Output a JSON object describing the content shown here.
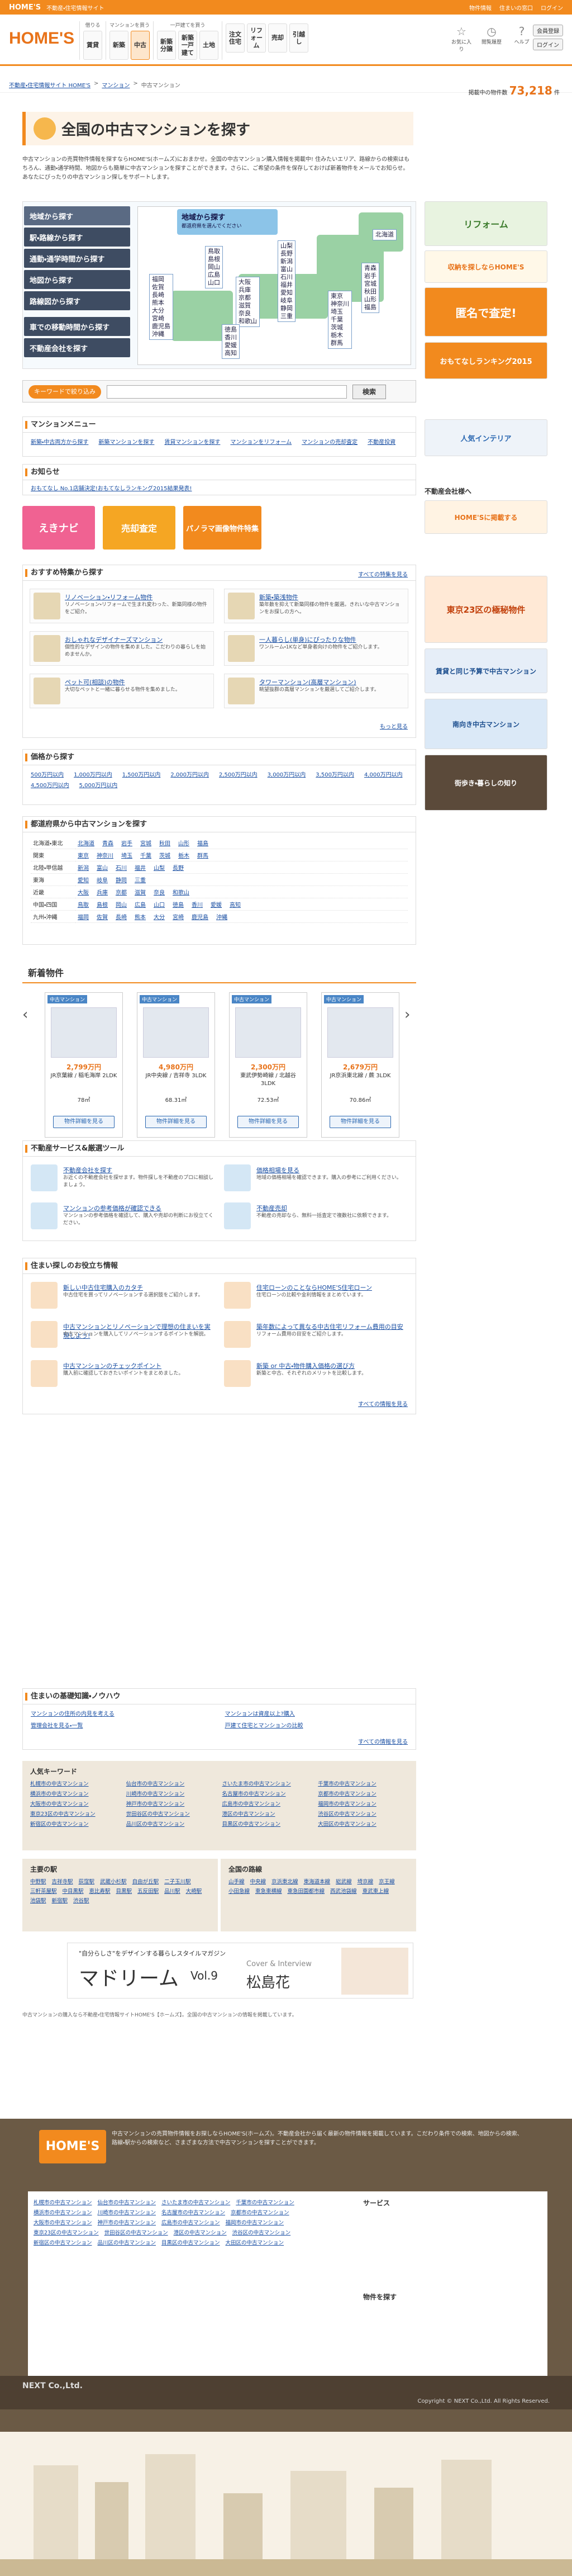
{
  "topbar": {
    "brand": "HOME'S",
    "tagline": "不動産・住宅情報サイト",
    "links": [
      "物件情報",
      "住まいの窓口",
      "ログイン"
    ]
  },
  "header": {
    "logo": "HOME'S",
    "gnav": [
      {
        "cap": "借りる",
        "items": [
          "賃貸"
        ]
      },
      {
        "cap": "マンションを買う",
        "items": [
          "新築",
          "中古"
        ]
      },
      {
        "cap": "一戸建てを買う",
        "items": [
          "新築分譲",
          "新築一戸建て",
          "土地"
        ]
      },
      {
        "cap": "",
        "items": [
          "注文住宅",
          "リフォーム",
          "売却",
          "引越し"
        ]
      }
    ],
    "icons": [
      {
        "name": "お気に入り",
        "g": "☆"
      },
      {
        "name": "閲覧履歴",
        "g": "◷"
      },
      {
        "name": "ヘルプ",
        "g": "?"
      }
    ],
    "buttons": [
      "会員登録",
      "ログイン"
    ]
  },
  "breadcrumb": {
    "crumbs": [
      "不動産・住宅情報サイト HOME'S",
      "マンション",
      "中古マンション"
    ]
  },
  "count": {
    "label": "掲載中の物件数",
    "value": "73,218",
    "unit": "件"
  },
  "page": {
    "title": "全国の中古マンションを探す",
    "intro": "中古マンションの売買物件情報を探すならHOME'S(ホームズ)におまかせ。全国の中古マンション購入情報を掲載中! 住みたいエリア、路線からの検索はもちろん、通勤・通学時間、地図からも簡単に中古マンションを探すことができます。さらに、ご希望の条件を保存しておけば新着物件をメールでお知らせ。あなたにぴったりの中古マンション探しをサポートします。"
  },
  "search": {
    "buttons": [
      "地域から探す",
      "駅・路線から探す",
      "通勤・通学時間から探す",
      "地図から探す",
      "路線図から探す",
      "車での移動時間から探す",
      "不動産会社を探す"
    ],
    "map_title": "地域から探す",
    "map_sub": "都道府県を選んでください",
    "prefs_north": [
      "北海道"
    ],
    "prefs_tohoku": [
      "青森",
      "岩手",
      "宮城",
      "秋田",
      "山形",
      "福島"
    ],
    "prefs_kanto": [
      "東京",
      "神奈川",
      "埼玉",
      "千葉",
      "茨城",
      "栃木",
      "群馬"
    ],
    "prefs_chubu": [
      "山梨",
      "長野",
      "新潟",
      "富山",
      "石川",
      "福井",
      "愛知",
      "岐阜",
      "静岡",
      "三重"
    ],
    "prefs_kinki": [
      "大阪",
      "兵庫",
      "京都",
      "滋賀",
      "奈良",
      "和歌山"
    ],
    "prefs_west": [
      "鳥取",
      "島根",
      "岡山",
      "広島",
      "山口"
    ],
    "prefs_shikoku": [
      "徳島",
      "香川",
      "愛媛",
      "高知"
    ],
    "prefs_kyushu": [
      "福岡",
      "佐賀",
      "長崎",
      "熊本",
      "大分",
      "宮崎",
      "鹿児島",
      "沖縄"
    ]
  },
  "keyword": {
    "label": "キーワードで絞り込み",
    "button": "検索"
  },
  "menu": {
    "title": "マンションメニュー",
    "links": [
      "新築・中古両方から探す",
      "新築マンションを探す",
      "賃貸マンションを探す",
      "マンションをリフォーム",
      "マンションの売却査定",
      "不動産投資"
    ]
  },
  "notice": {
    "title": "お知らせ",
    "text": "おもてなし No.1店舗決定!おもてなしランキング2015結果発表!"
  },
  "promos": [
    "えきナビ",
    "売却査定",
    "パノラマ画像物件特集"
  ],
  "features": {
    "title": "おすすめ特集から探す",
    "more": "すべての特集を見る",
    "items": [
      {
        "t1": "リノベーション・リフォーム物件",
        "t2": "リノベーション・リフォームで生まれ変わった、新築同様の物件をご紹介。"
      },
      {
        "t1": "新築・築浅物件",
        "t2": "築年数を抑えて新築同様の物件を厳選。きれいな中古マンションをお探しの方へ。"
      },
      {
        "t1": "おしゃれなデザイナーズマンション",
        "t2": "個性的なデザインの物件を集めました。こだわりの暮らしを始めませんか。"
      },
      {
        "t1": "一人暮らし(単身)にぴったりな物件",
        "t2": "ワンルーム・1Kなど単身者向けの物件をご紹介します。"
      },
      {
        "t1": "ペット可(相談)の物件",
        "t2": "大切なペットと一緒に暮らせる物件を集めました。"
      },
      {
        "t1": "タワーマンション(高層マンション)",
        "t2": "眺望抜群の高層マンションを厳選してご紹介します。"
      }
    ],
    "more2": "もっと見る"
  },
  "price": {
    "title": "価格から探す",
    "links": [
      "500万円以内",
      "1,000万円以内",
      "1,500万円以内",
      "2,000万円以内",
      "2,500万円以内",
      "3,000万円以内",
      "3,500万円以内",
      "4,000万円以内",
      "4,500万円以内",
      "5,000万円以内"
    ]
  },
  "region": {
    "title": "都道府県から中古マンションを探す",
    "rows": [
      {
        "r": "北海道・東北",
        "p": [
          "北海道",
          "青森",
          "岩手",
          "宮城",
          "秋田",
          "山形",
          "福島"
        ]
      },
      {
        "r": "関東",
        "p": [
          "東京",
          "神奈川",
          "埼玉",
          "千葉",
          "茨城",
          "栃木",
          "群馬"
        ]
      },
      {
        "r": "北陸・甲信越",
        "p": [
          "新潟",
          "富山",
          "石川",
          "福井",
          "山梨",
          "長野"
        ]
      },
      {
        "r": "東海",
        "p": [
          "愛知",
          "岐阜",
          "静岡",
          "三重"
        ]
      },
      {
        "r": "近畿",
        "p": [
          "大阪",
          "兵庫",
          "京都",
          "滋賀",
          "奈良",
          "和歌山"
        ]
      },
      {
        "r": "中国・四国",
        "p": [
          "鳥取",
          "島根",
          "岡山",
          "広島",
          "山口",
          "徳島",
          "香川",
          "愛媛",
          "高知"
        ]
      },
      {
        "r": "九州・沖縄",
        "p": [
          "福岡",
          "佐賀",
          "長崎",
          "熊本",
          "大分",
          "宮崎",
          "鹿児島",
          "沖縄"
        ]
      }
    ]
  },
  "newprops": {
    "title": "新着物件",
    "cards": [
      {
        "badge": "中古マンション",
        "price": "2,799万円",
        "name": "JR京葉線 / 稲毛海岸 2LDK",
        "area": "78㎡",
        "go": "物件詳細を見る"
      },
      {
        "badge": "中古マンション",
        "price": "4,980万円",
        "name": "JR中央線 / 吉祥寺 3LDK",
        "area": "68.31㎡",
        "go": "物件詳細を見る"
      },
      {
        "badge": "中古マンション",
        "price": "2,300万円",
        "name": "東武伊勢崎線 / 北越谷 3LDK",
        "area": "72.53㎡",
        "go": "物件詳細を見る"
      },
      {
        "badge": "中古マンション",
        "price": "2,679万円",
        "name": "JR京浜東北線 / 蕨 3LDK",
        "area": "70.86㎡",
        "go": "物件詳細を見る"
      }
    ]
  },
  "tools": {
    "title": "不動産サービス&厳選ツール",
    "items": [
      {
        "t1": "不動産会社を探す",
        "t2": "お近くの不動産会社を探せます。物件探しを不動産のプロに相談しましょう。"
      },
      {
        "t1": "価格相場を見る",
        "t2": "地域の価格相場を確認できます。購入の参考にご利用ください。"
      },
      {
        "t1": "マンションの参考価格が確認できる",
        "t2": "マンションの参考価格を確認して、購入や売却の判断にお役立てください。"
      },
      {
        "t1": "不動産売却",
        "t2": "不動産の売却なら、無料一括査定で複数社に依頼できます。"
      }
    ]
  },
  "info": {
    "title": "住まい探しのお役立ち情報",
    "items": [
      {
        "t1": "新しい中古住宅購入のカタチ",
        "t2": "中古住宅を買ってリノベーションする選択肢をご紹介します。"
      },
      {
        "t1": "住宅ローンのことならHOME'S住宅ローン",
        "t2": "住宅ローンの比較や金利情報をまとめています。"
      },
      {
        "t1": "中古マンションとリノベーションで理想の住まいを実現しよう!",
        "t2": "中古マンションを購入してリノベーションするポイントを解説。"
      },
      {
        "t1": "築年数によって異なる中古住宅リフォーム費用の目安",
        "t2": "リフォーム費用の目安をご紹介します。"
      },
      {
        "t1": "中古マンションのチェックポイント",
        "t2": "購入前に確認しておきたいポイントをまとめました。"
      },
      {
        "t1": "新築 or 中古・物件購入価格の選び方",
        "t2": "新築と中古、それぞれのメリットを比較します。"
      }
    ],
    "more": "すべての情報を見る"
  },
  "knowhow": {
    "title": "住まいの基礎知識・ノウハウ",
    "links": [
      "マンションの住所の内見を考える",
      "管理会社を見る・一覧",
      "マンションは資産以上?購入",
      "戸建て住宅とマンションの比較",
      "マンション購入の流れ",
      "資金計画の立て方"
    ],
    "more": "すべての情報を見る"
  },
  "keywords": {
    "title": "人気キーワード",
    "items": [
      "札幌市の中古マンション",
      "仙台市の中古マンション",
      "さいたま市の中古マンション",
      "千葉市の中古マンション",
      "横浜市の中古マンション",
      "川崎市の中古マンション",
      "名古屋市の中古マンション",
      "京都市の中古マンション",
      "大阪市の中古マンション",
      "神戸市の中古マンション",
      "広島市の中古マンション",
      "福岡市の中古マンション",
      "東京23区の中古マンション",
      "世田谷区の中古マンション",
      "港区の中古マンション",
      "渋谷区の中古マンション",
      "新宿区の中古マンション",
      "品川区の中古マンション",
      "目黒区の中古マンション",
      "大田区の中古マンション"
    ]
  },
  "stations": {
    "left_title": "主要の駅",
    "left": [
      "中野駅",
      "吉祥寺駅",
      "荻窪駅",
      "武蔵小杉駅",
      "自由が丘駅",
      "二子玉川駅",
      "三軒茶屋駅",
      "中目黒駅",
      "恵比寿駅",
      "目黒駅",
      "五反田駅",
      "品川駅",
      "大崎駅",
      "池袋駅",
      "新宿駅",
      "渋谷駅"
    ],
    "right_title": "全国の路線",
    "right": [
      "山手線",
      "中央線",
      "京浜東北線",
      "東海道本線",
      "総武線",
      "埼京線",
      "京王線",
      "小田急線",
      "東急東横線",
      "東急田園都市線",
      "西武池袋線",
      "東武東上線"
    ]
  },
  "magazine": {
    "kicker": "\"自分らしさ\"をデザインする暮らしスタイルマガジン",
    "title": "マドリーム",
    "vol": "Vol.9",
    "cover": "Cover & Interview",
    "person": "松島花"
  },
  "disclaimer": "中古マンションの購入なら不動産・住宅情報サイトHOME'S【ホームズ】。全国の中古マンションの情報を掲載しています。",
  "sidebar": {
    "b1": "リフォーム",
    "b2": "収納を探しならHOME'S",
    "b3": "匿名で査定!",
    "b4": "おもてなしランキング2015",
    "b5": "人気インテリア",
    "b6": "不動産会社様へ",
    "b7": "HOME'Sに掲載する",
    "b8": "東京23区の極秘物件",
    "b9": "賃貸と同じ予算で中古マンション",
    "b10": "南向き中古マンション",
    "b11": "街歩き・暮らしの知り"
  },
  "footer": {
    "logo": "HOME'S",
    "desc": "中古マンションの売買物件情報をお探しならHOME'S(ホームズ)。不動産会社から届く最新の物件情報を掲載しています。こだわり条件での検索、地図からの検索、路線・駅からの検索など、さまざまな方法で中古マンションを探すことができます。",
    "services_title": "サービス",
    "bukken_title": "物件を探す",
    "company": "NEXT Co.,Ltd.",
    "copyright": "Copyright © NEXT Co.,Ltd. All Rights Reserved."
  }
}
